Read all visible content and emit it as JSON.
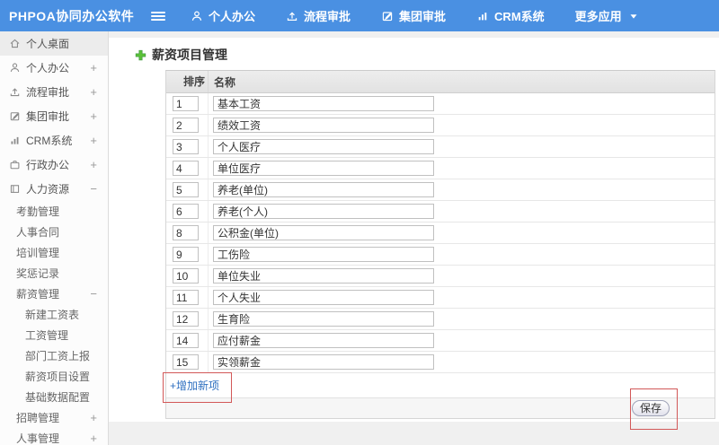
{
  "colors": {
    "topbar": "#4a90e2",
    "link": "#2e6fc0",
    "annotation": "#d25858",
    "plus_green": "#5bc236"
  },
  "topbar": {
    "brand": "PHPOA协同办公软件",
    "menu_icon": "hamburger-icon",
    "menu": [
      {
        "name": "personal-office",
        "label": "个人办公",
        "icon": "user-icon"
      },
      {
        "name": "flow-approval",
        "label": "流程审批",
        "icon": "upload-icon"
      },
      {
        "name": "group-approval",
        "label": "集团审批",
        "icon": "edit-icon"
      },
      {
        "name": "crm-system",
        "label": "CRM系统",
        "icon": "chart-icon"
      },
      {
        "name": "more-apps",
        "label": "更多应用",
        "icon": "caret-down-icon"
      }
    ]
  },
  "sidebar": {
    "items": [
      {
        "name": "personal-desktop",
        "label": "个人桌面",
        "icon": "home-icon",
        "level": 0,
        "active": true
      },
      {
        "name": "personal-office",
        "label": "个人办公",
        "icon": "user-icon",
        "level": 0,
        "expand": "+"
      },
      {
        "name": "flow-approval",
        "label": "流程审批",
        "icon": "upload-icon",
        "level": 0,
        "expand": "+"
      },
      {
        "name": "group-approval",
        "label": "集团审批",
        "icon": "edit-icon",
        "level": 0,
        "expand": "+"
      },
      {
        "name": "crm-system",
        "label": "CRM系统",
        "icon": "chart-icon",
        "level": 0,
        "expand": "+"
      },
      {
        "name": "admin-office",
        "label": "行政办公",
        "icon": "briefcase-icon",
        "level": 0,
        "expand": "+"
      },
      {
        "name": "human-resources",
        "label": "人力资源",
        "icon": "book-icon",
        "level": 0,
        "expand": "−"
      },
      {
        "name": "attendance-mgmt",
        "label": "考勤管理",
        "level": 1
      },
      {
        "name": "hr-contract",
        "label": "人事合同",
        "level": 1
      },
      {
        "name": "training-mgmt",
        "label": "培训管理",
        "level": 1
      },
      {
        "name": "reward-records",
        "label": "奖惩记录",
        "level": 1
      },
      {
        "name": "salary-mgmt",
        "label": "薪资管理",
        "level": 1,
        "expand": "−"
      },
      {
        "name": "new-salary-sheet",
        "label": "新建工资表",
        "level": 2
      },
      {
        "name": "wage-mgmt",
        "label": "工资管理",
        "level": 2
      },
      {
        "name": "dept-wage-report",
        "label": "部门工资上报",
        "level": 2
      },
      {
        "name": "salary-item-setup",
        "label": "薪资项目设置",
        "level": 2
      },
      {
        "name": "base-data-config",
        "label": "基础数据配置",
        "level": 2
      },
      {
        "name": "recruit-mgmt",
        "label": "招聘管理",
        "level": 1,
        "expand": "+"
      },
      {
        "name": "personnel-mgmt",
        "label": "人事管理",
        "level": 1,
        "expand": "+"
      }
    ]
  },
  "main": {
    "title": "薪资项目管理",
    "title_icon": "plus-icon",
    "table": {
      "headers": [
        "排序",
        "名称"
      ],
      "rows": [
        {
          "order": "1",
          "name": "基本工资"
        },
        {
          "order": "2",
          "name": "绩效工资"
        },
        {
          "order": "3",
          "name": "个人医疗"
        },
        {
          "order": "4",
          "name": "单位医疗"
        },
        {
          "order": "5",
          "name": "养老(单位)"
        },
        {
          "order": "6",
          "name": "养老(个人)"
        },
        {
          "order": "8",
          "name": "公积金(单位)"
        },
        {
          "order": "9",
          "name": "工伤险"
        },
        {
          "order": "10",
          "name": "单位失业"
        },
        {
          "order": "11",
          "name": "个人失业"
        },
        {
          "order": "12",
          "name": "生育险"
        },
        {
          "order": "14",
          "name": "应付薪金"
        },
        {
          "order": "15",
          "name": "实领薪金"
        }
      ]
    },
    "add_link": "+增加新项",
    "save_label": "保存"
  }
}
